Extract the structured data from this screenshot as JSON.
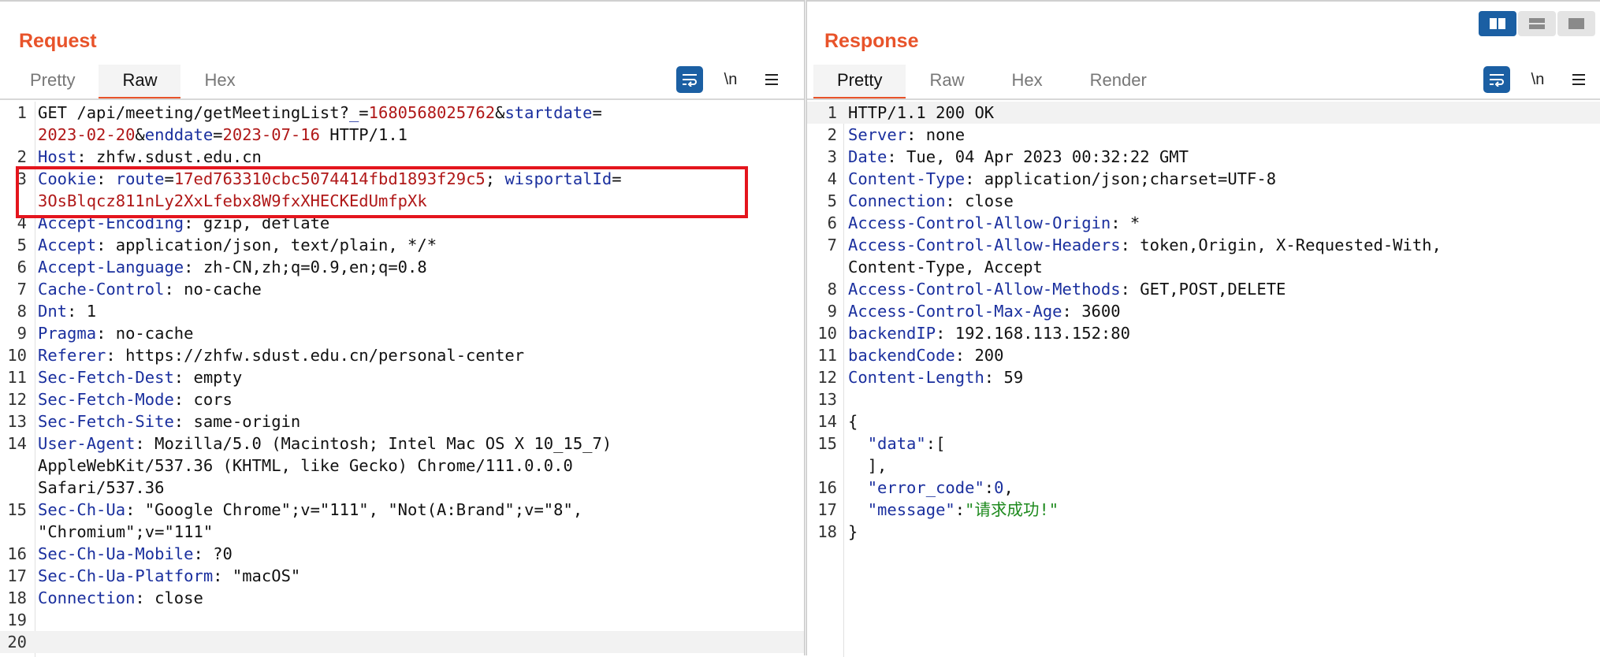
{
  "request": {
    "title": "Request",
    "tabs": [
      {
        "label": "Pretty",
        "active": false
      },
      {
        "label": "Raw",
        "active": true
      },
      {
        "label": "Hex",
        "active": false
      }
    ],
    "newline_label": "\\n",
    "lines": [
      {
        "n": "1",
        "rows": [
          [
            {
              "t": "GET /api/meeting/getMeetingList?"
            },
            {
              "t": "_",
              "c": "k"
            },
            {
              "t": "="
            },
            {
              "t": "1680568025762",
              "c": "v"
            },
            {
              "t": "&"
            },
            {
              "t": "startdate",
              "c": "k"
            },
            {
              "t": "="
            }
          ],
          [
            {
              "t": "2023-02-20",
              "c": "v"
            },
            {
              "t": "&"
            },
            {
              "t": "enddate",
              "c": "k"
            },
            {
              "t": "="
            },
            {
              "t": "2023-07-16",
              "c": "v"
            },
            {
              "t": " HTTP/1.1"
            }
          ]
        ]
      },
      {
        "n": "2",
        "rows": [
          [
            {
              "t": "Host",
              "c": "k"
            },
            {
              "t": ": zhfw.sdust.edu.cn"
            }
          ]
        ]
      },
      {
        "n": "3",
        "rows": [
          [
            {
              "t": "Cookie",
              "c": "k"
            },
            {
              "t": ": "
            },
            {
              "t": "route",
              "c": "k"
            },
            {
              "t": "="
            },
            {
              "t": "17ed763310cbc5074414fbd1893f29c5",
              "c": "v"
            },
            {
              "t": "; "
            },
            {
              "t": "wisportalId",
              "c": "k"
            },
            {
              "t": "="
            }
          ],
          [
            {
              "t": "3OsBlqcz811nLy2XxLfebx8W9fxXHECKEdUmfpXk",
              "c": "v"
            }
          ]
        ]
      },
      {
        "n": "4",
        "rows": [
          [
            {
              "t": "Accept-Encoding",
              "c": "k"
            },
            {
              "t": ": gzip, deflate"
            }
          ]
        ]
      },
      {
        "n": "5",
        "rows": [
          [
            {
              "t": "Accept",
              "c": "k"
            },
            {
              "t": ": application/json, text/plain, */*"
            }
          ]
        ]
      },
      {
        "n": "6",
        "rows": [
          [
            {
              "t": "Accept-Language",
              "c": "k"
            },
            {
              "t": ": zh-CN,zh;q=0.9,en;q=0.8"
            }
          ]
        ]
      },
      {
        "n": "7",
        "rows": [
          [
            {
              "t": "Cache-Control",
              "c": "k"
            },
            {
              "t": ": no-cache"
            }
          ]
        ]
      },
      {
        "n": "8",
        "rows": [
          [
            {
              "t": "Dnt",
              "c": "k"
            },
            {
              "t": ": 1"
            }
          ]
        ]
      },
      {
        "n": "9",
        "rows": [
          [
            {
              "t": "Pragma",
              "c": "k"
            },
            {
              "t": ": no-cache"
            }
          ]
        ]
      },
      {
        "n": "10",
        "rows": [
          [
            {
              "t": "Referer",
              "c": "k"
            },
            {
              "t": ": https://zhfw.sdust.edu.cn/personal-center"
            }
          ]
        ]
      },
      {
        "n": "11",
        "rows": [
          [
            {
              "t": "Sec-Fetch-Dest",
              "c": "k"
            },
            {
              "t": ": empty"
            }
          ]
        ]
      },
      {
        "n": "12",
        "rows": [
          [
            {
              "t": "Sec-Fetch-Mode",
              "c": "k"
            },
            {
              "t": ": cors"
            }
          ]
        ]
      },
      {
        "n": "13",
        "rows": [
          [
            {
              "t": "Sec-Fetch-Site",
              "c": "k"
            },
            {
              "t": ": same-origin"
            }
          ]
        ]
      },
      {
        "n": "14",
        "rows": [
          [
            {
              "t": "User-Agent",
              "c": "k"
            },
            {
              "t": ": Mozilla/5.0 (Macintosh; Intel Mac OS X 10_15_7)"
            }
          ],
          [
            {
              "t": "AppleWebKit/537.36 (KHTML, like Gecko) Chrome/111.0.0.0"
            }
          ],
          [
            {
              "t": "Safari/537.36"
            }
          ]
        ]
      },
      {
        "n": "15",
        "rows": [
          [
            {
              "t": "Sec-Ch-Ua",
              "c": "k"
            },
            {
              "t": ": \"Google Chrome\";v=\"111\", \"Not(A:Brand\";v=\"8\","
            }
          ],
          [
            {
              "t": "\"Chromium\";v=\"111\""
            }
          ]
        ]
      },
      {
        "n": "16",
        "rows": [
          [
            {
              "t": "Sec-Ch-Ua-Mobile",
              "c": "k"
            },
            {
              "t": ": ?0"
            }
          ]
        ]
      },
      {
        "n": "17",
        "rows": [
          [
            {
              "t": "Sec-Ch-Ua-Platform",
              "c": "k"
            },
            {
              "t": ": \"macOS\""
            }
          ]
        ]
      },
      {
        "n": "18",
        "rows": [
          [
            {
              "t": "Connection",
              "c": "k"
            },
            {
              "t": ": close"
            }
          ]
        ]
      },
      {
        "n": "19",
        "rows": [
          [
            {
              "t": ""
            }
          ]
        ]
      },
      {
        "n": "20",
        "rows": [
          [
            {
              "t": ""
            }
          ]
        ],
        "current": true
      }
    ]
  },
  "response": {
    "title": "Response",
    "tabs": [
      {
        "label": "Pretty",
        "active": true
      },
      {
        "label": "Raw",
        "active": false
      },
      {
        "label": "Hex",
        "active": false
      },
      {
        "label": "Render",
        "active": false
      }
    ],
    "newline_label": "\\n",
    "lines": [
      {
        "n": "1",
        "rows": [
          [
            {
              "t": "HTTP/1.1 200 OK"
            }
          ]
        ],
        "current": true
      },
      {
        "n": "2",
        "rows": [
          [
            {
              "t": "Server",
              "c": "k"
            },
            {
              "t": ": none"
            }
          ]
        ]
      },
      {
        "n": "3",
        "rows": [
          [
            {
              "t": "Date",
              "c": "k"
            },
            {
              "t": ": Tue, 04 Apr 2023 00:32:22 GMT"
            }
          ]
        ]
      },
      {
        "n": "4",
        "rows": [
          [
            {
              "t": "Content-Type",
              "c": "k"
            },
            {
              "t": ": application/json;charset=UTF-8"
            }
          ]
        ]
      },
      {
        "n": "5",
        "rows": [
          [
            {
              "t": "Connection",
              "c": "k"
            },
            {
              "t": ": close"
            }
          ]
        ]
      },
      {
        "n": "6",
        "rows": [
          [
            {
              "t": "Access-Control-Allow-Origin",
              "c": "k"
            },
            {
              "t": ": *"
            }
          ]
        ]
      },
      {
        "n": "7",
        "rows": [
          [
            {
              "t": "Access-Control-Allow-Headers",
              "c": "k"
            },
            {
              "t": ": token,Origin, X-Requested-With,"
            }
          ],
          [
            {
              "t": "Content-Type, Accept"
            }
          ]
        ]
      },
      {
        "n": "8",
        "rows": [
          [
            {
              "t": "Access-Control-Allow-Methods",
              "c": "k"
            },
            {
              "t": ": GET,POST,DELETE"
            }
          ]
        ]
      },
      {
        "n": "9",
        "rows": [
          [
            {
              "t": "Access-Control-Max-Age",
              "c": "k"
            },
            {
              "t": ": 3600"
            }
          ]
        ]
      },
      {
        "n": "10",
        "rows": [
          [
            {
              "t": "backendIP",
              "c": "k"
            },
            {
              "t": ": 192.168.113.152:80"
            }
          ]
        ]
      },
      {
        "n": "11",
        "rows": [
          [
            {
              "t": "backendCode",
              "c": "k"
            },
            {
              "t": ": 200"
            }
          ]
        ]
      },
      {
        "n": "12",
        "rows": [
          [
            {
              "t": "Content-Length",
              "c": "k"
            },
            {
              "t": ": 59"
            }
          ]
        ]
      },
      {
        "n": "13",
        "rows": [
          [
            {
              "t": ""
            }
          ]
        ]
      },
      {
        "n": "14",
        "rows": [
          [
            {
              "t": "{"
            }
          ]
        ]
      },
      {
        "n": "15",
        "rows": [
          [
            {
              "t": "  "
            },
            {
              "t": "\"data\"",
              "c": "k"
            },
            {
              "t": ":["
            }
          ],
          [
            {
              "t": "  ],"
            }
          ]
        ]
      },
      {
        "n": "16",
        "rows": [
          [
            {
              "t": "  "
            },
            {
              "t": "\"error_code\"",
              "c": "k"
            },
            {
              "t": ":"
            },
            {
              "t": "0",
              "c": "n"
            },
            {
              "t": ","
            }
          ]
        ]
      },
      {
        "n": "17",
        "rows": [
          [
            {
              "t": "  "
            },
            {
              "t": "\"message\"",
              "c": "k"
            },
            {
              "t": ":"
            },
            {
              "t": "\"请求成功!\"",
              "c": "s"
            }
          ]
        ]
      },
      {
        "n": "18",
        "rows": [
          [
            {
              "t": "}"
            }
          ]
        ]
      }
    ]
  },
  "layout_switch": {
    "options": [
      "split-horizontal-icon",
      "split-vertical-icon",
      "single-pane-icon"
    ],
    "active": "split-horizontal-icon"
  },
  "colors": {
    "accent": "#e8532a",
    "header_key": "#1a2f9e",
    "header_value": "#b01818",
    "json_string": "#1e8a1e",
    "tool_button": "#1b5fa3",
    "highlight_box": "#e4151d"
  }
}
